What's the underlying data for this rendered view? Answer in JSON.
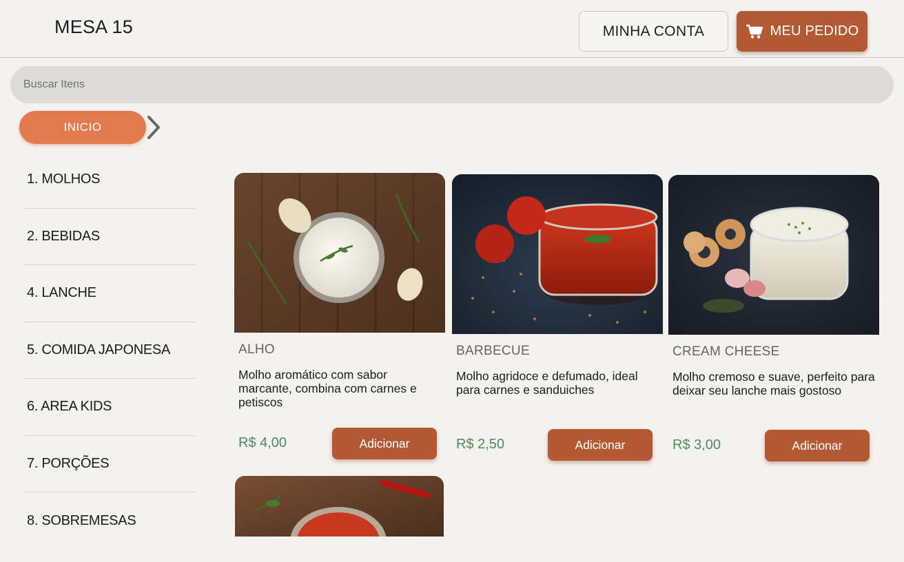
{
  "header": {
    "table_label": "MESA 15",
    "account_label": "MINHA CONTA",
    "order_label": "MEU PEDIDO",
    "order_icon": "cart-icon"
  },
  "search": {
    "placeholder": "Buscar Itens"
  },
  "breadcrumb": {
    "home_label": "INICIO",
    "separator_icon": "chevron-right-icon"
  },
  "sidebar": {
    "items": [
      {
        "label": "1. MOLHOS"
      },
      {
        "label": "2. BEBIDAS"
      },
      {
        "label": "4. LANCHE"
      },
      {
        "label": "5. COMIDA JAPONESA"
      },
      {
        "label": "6. AREA KIDS"
      },
      {
        "label": "7. PORÇÕES"
      },
      {
        "label": "8. SOBREMESAS"
      }
    ]
  },
  "products": [
    {
      "name": "ALHO",
      "description": "Molho aromático com sabor marcante, combina com carnes e petiscos",
      "price": "R$ 4,00",
      "button_label": "Adicionar"
    },
    {
      "name": "BARBECUE",
      "description": "Molho agridoce e defumado, ideal para carnes e sanduiches",
      "price": "R$ 2,50",
      "button_label": "Adicionar"
    },
    {
      "name": "CREAM CHEESE",
      "description": "Molho cremoso e suave, perfeito para deixar seu lanche mais gostoso",
      "price": "R$ 3,00",
      "button_label": "Adicionar"
    }
  ],
  "colors": {
    "accent": "#b35a34",
    "home_pill": "#e27a4d",
    "price": "#4d8a5e",
    "background": "#f3f2ef"
  }
}
